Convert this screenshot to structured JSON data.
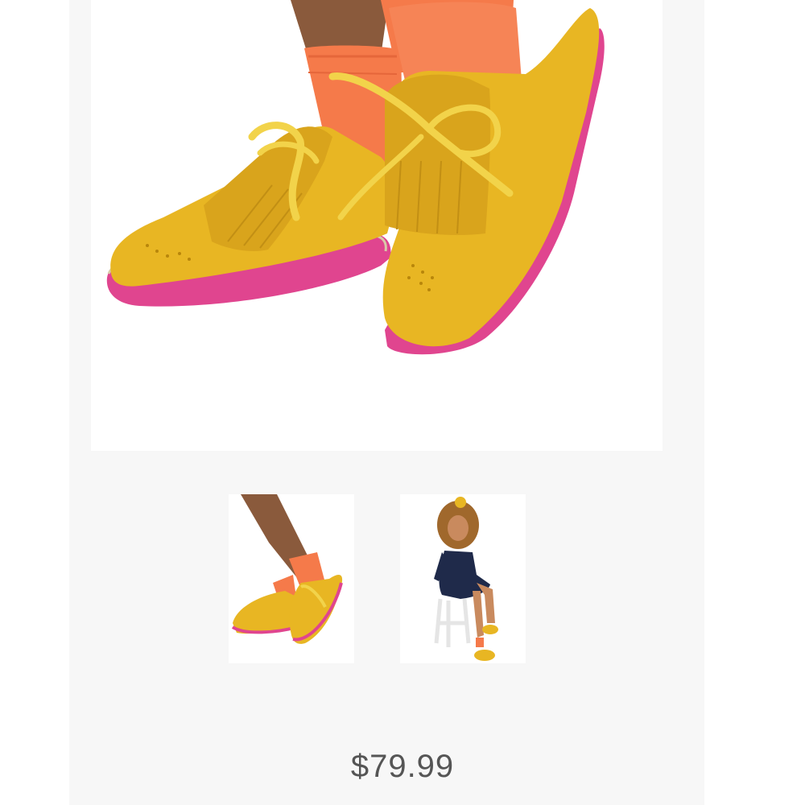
{
  "product": {
    "price": "$79.99"
  },
  "gallery": {
    "thumbnail_count": 2
  },
  "colors": {
    "panel_background": "#f7f7f7",
    "shoe_suede": "#e8b623",
    "sole_pink": "#e0458f",
    "sock_orange": "#f57a4a"
  }
}
